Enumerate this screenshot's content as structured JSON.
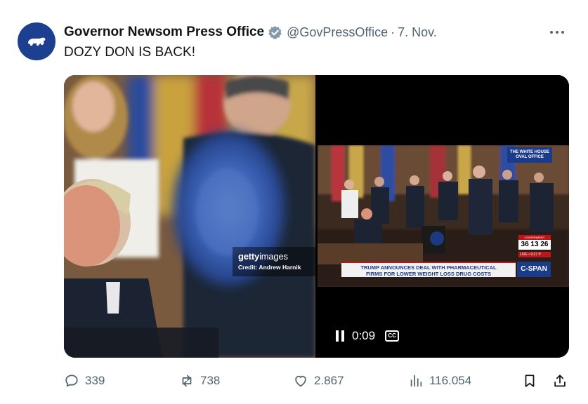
{
  "tweet": {
    "author_name": "Governor Newsom Press Office",
    "handle": "@GovPressOffice",
    "separator": "·",
    "date": "7. Nov.",
    "text": "DOZY DON IS BACK!",
    "avatar_icon": "california-bear-icon",
    "verified_icon": "verified-badge-icon",
    "more_icon": "more-options-icon"
  },
  "media": {
    "left_photo": {
      "watermark_brand": "getty",
      "watermark_brand_suffix": "images",
      "credit": "Credit: Andrew Harnik"
    },
    "right_video": {
      "badge_line1": "THE WHITE HOUSE",
      "badge_line2": "OVAL OFFICE",
      "clock_label": "GOVERNMENT SHUTDOWN",
      "clock_value": "36 13 26",
      "live_label": "LIVE • 9:27 P",
      "chyron_line1": "TRUMP ANNOUNCES DEAL WITH PHARMACEUTICAL",
      "chyron_line2": "FIRMS FOR LOWER WEIGHT LOSS DRUG COSTS",
      "network": "C-SPAN",
      "time": "0:09",
      "cc_label": "CC"
    }
  },
  "actions": {
    "replies": "339",
    "reposts": "738",
    "likes": "2.867",
    "views": "116.054"
  },
  "colors": {
    "text": "#0f1419",
    "muted": "#536471",
    "verified": "#829aab",
    "avatar_bg": "#1d3f8f",
    "cspan_blue": "#1a3a8a",
    "cspan_red": "#c0141b"
  }
}
